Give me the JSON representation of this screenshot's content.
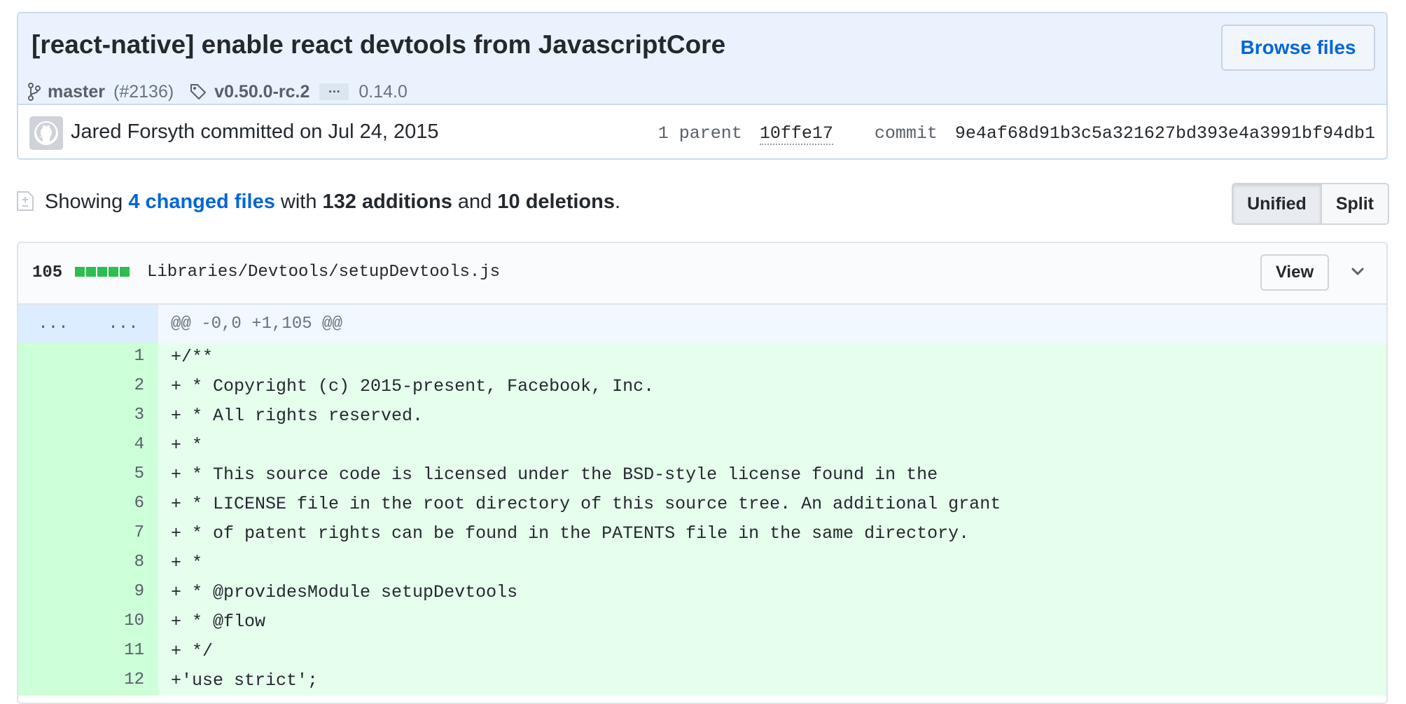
{
  "commit": {
    "title": "[react-native] enable react devtools from JavascriptCore",
    "browse_files_label": "Browse files",
    "branch": "master",
    "pr": "(#2136)",
    "tag": "v0.50.0-rc.2",
    "ellipsis": "…",
    "older_tag": "0.14.0",
    "author_line": "Jared Forsyth committed on Jul 24, 2015",
    "parent_label": "1 parent",
    "parent_sha": "10ffe17",
    "commit_label": "commit",
    "commit_sha": "9e4af68d91b3c5a321627bd393e4a3991bf94db1"
  },
  "toc": {
    "showing": "Showing",
    "changed_files": "4 changed files",
    "with": "with",
    "additions": "132 additions",
    "and": "and",
    "deletions": "10 deletions",
    "period": "."
  },
  "diff_toggle": {
    "unified": "Unified",
    "split": "Split"
  },
  "file": {
    "count": "105",
    "path": "Libraries/Devtools/setupDevtools.js",
    "view_label": "View",
    "hunk_old": "...",
    "hunk_new": "...",
    "hunk_header": "@@ -0,0 +1,105 @@",
    "lines": [
      {
        "n": "1",
        "code": "+/**"
      },
      {
        "n": "2",
        "code": "+ * Copyright (c) 2015-present, Facebook, Inc."
      },
      {
        "n": "3",
        "code": "+ * All rights reserved."
      },
      {
        "n": "4",
        "code": "+ *"
      },
      {
        "n": "5",
        "code": "+ * This source code is licensed under the BSD-style license found in the"
      },
      {
        "n": "6",
        "code": "+ * LICENSE file in the root directory of this source tree. An additional grant"
      },
      {
        "n": "7",
        "code": "+ * of patent rights can be found in the PATENTS file in the same directory."
      },
      {
        "n": "8",
        "code": "+ *"
      },
      {
        "n": "9",
        "code": "+ * @providesModule setupDevtools"
      },
      {
        "n": "10",
        "code": "+ * @flow"
      },
      {
        "n": "11",
        "code": "+ */"
      },
      {
        "n": "12",
        "code": "+'use strict';"
      }
    ]
  },
  "colors": {
    "link": "#0366d6",
    "added_bg": "#e6ffed",
    "added_gutter": "#cdffd8",
    "diffstat": "#2cbe4e"
  }
}
